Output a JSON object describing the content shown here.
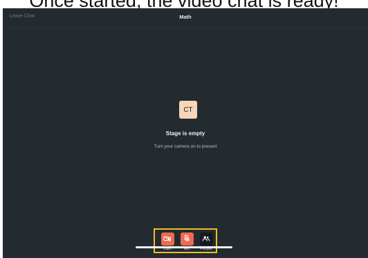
{
  "caption": "Once started, the video chat is ready!",
  "header": {
    "leave_label": "Leave Chat",
    "title": "Math"
  },
  "stage": {
    "avatar_initials": "CT",
    "title": "Stage is empty",
    "subtitle": "Turn your camera on to present"
  },
  "controls": [
    {
      "label": "Cam",
      "icon": "camera-off-icon",
      "state": "off",
      "color": "#ef6a4f"
    },
    {
      "label": "Mic",
      "icon": "mic-off-icon",
      "state": "off",
      "color": "#ef6a4f"
    },
    {
      "label": "People",
      "icon": "people-icon",
      "state": "neutral",
      "color": "#151a1e"
    }
  ],
  "colors": {
    "background": "#232a30",
    "accent_off": "#ef6a4f",
    "highlight_border": "#f1c21b",
    "avatar_bg": "#f7d6b9"
  }
}
